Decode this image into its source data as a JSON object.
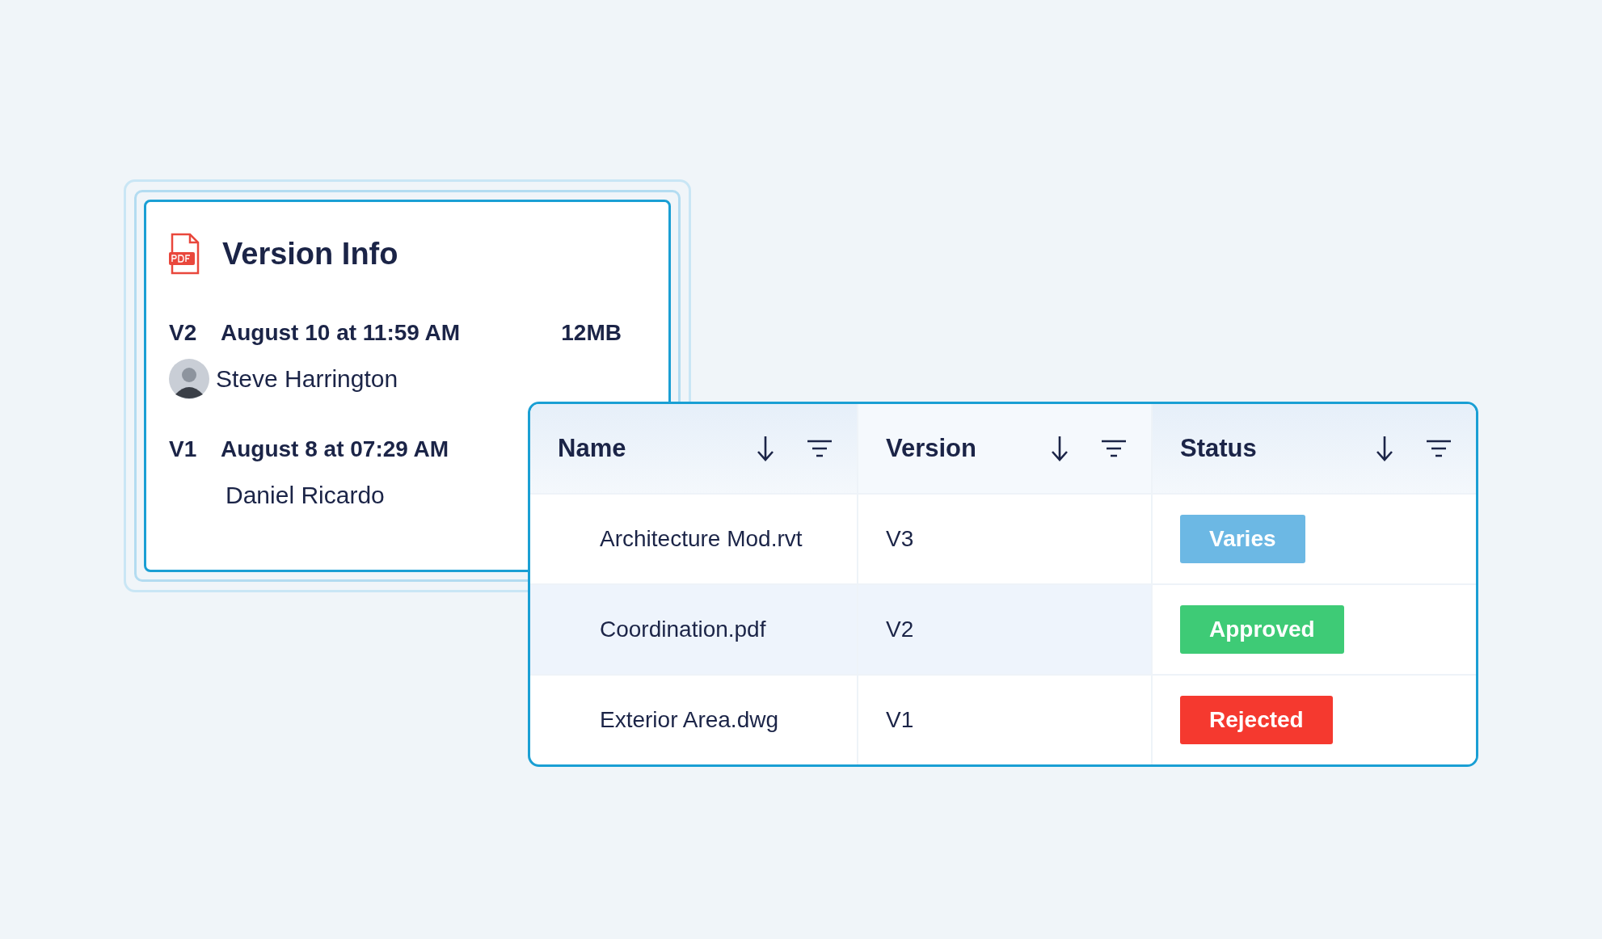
{
  "version_card": {
    "title": "Version Info",
    "versions": [
      {
        "label": "V2",
        "date": "August 10 at 11:59 AM",
        "size": "12MB",
        "author": "Steve Harrington",
        "avatar": true
      },
      {
        "label": "V1",
        "date": "August 8 at 07:29 AM",
        "author": "Daniel Ricardo"
      }
    ]
  },
  "table": {
    "columns": [
      {
        "label": "Name"
      },
      {
        "label": "Version"
      },
      {
        "label": "Status"
      }
    ],
    "rows": [
      {
        "name": "Architecture Mod.rvt",
        "version": "V3",
        "status": "Varies",
        "color": "#6cb8e4",
        "selected": false
      },
      {
        "name": "Coordination.pdf",
        "version": "V2",
        "status": "Approved",
        "color": "#3ecb76",
        "selected": true
      },
      {
        "name": "Exterior Area.dwg",
        "version": "V1",
        "status": "Rejected",
        "color": "#f5392f",
        "selected": false
      }
    ]
  }
}
